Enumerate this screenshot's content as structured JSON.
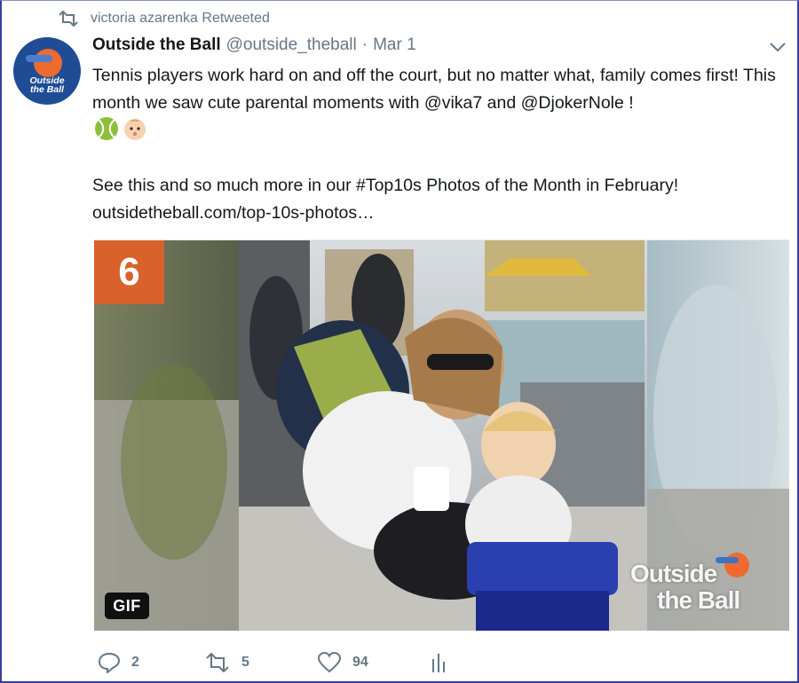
{
  "retweet_context": {
    "text": "victoria azarenka Retweeted",
    "icon": "retweet-icon"
  },
  "author": {
    "avatar_text_line1": "Outside",
    "avatar_text_line2": "the Ball",
    "display_name": "Outside the Ball",
    "handle": "@outside_theball",
    "separator": "·",
    "date": "Mar 1"
  },
  "tweet": {
    "line1": "Tennis players work hard on and off the court, but no matter what, family comes first! This month we saw cute parental moments with @vika7 and @DjokerNole !",
    "emojis": [
      "tennis-ball-emoji",
      "baby-emoji"
    ],
    "line2": "See this and so much more in our #Top10s Photos of the Month in February!",
    "link": "outsidetheball.com/top-10s-photos…"
  },
  "media": {
    "rank_badge": "6",
    "gif_label": "GIF",
    "watermark_line1": "Outside",
    "watermark_line2": "the Ball"
  },
  "actions": {
    "reply_count": "2",
    "retweet_count": "5",
    "like_count": "94",
    "icons": [
      "reply-icon",
      "retweet-icon",
      "heart-icon",
      "analytics-icon"
    ]
  },
  "colors": {
    "muted": "#657786",
    "brand_blue": "#1f4d95",
    "brand_orange": "#d9622c"
  }
}
